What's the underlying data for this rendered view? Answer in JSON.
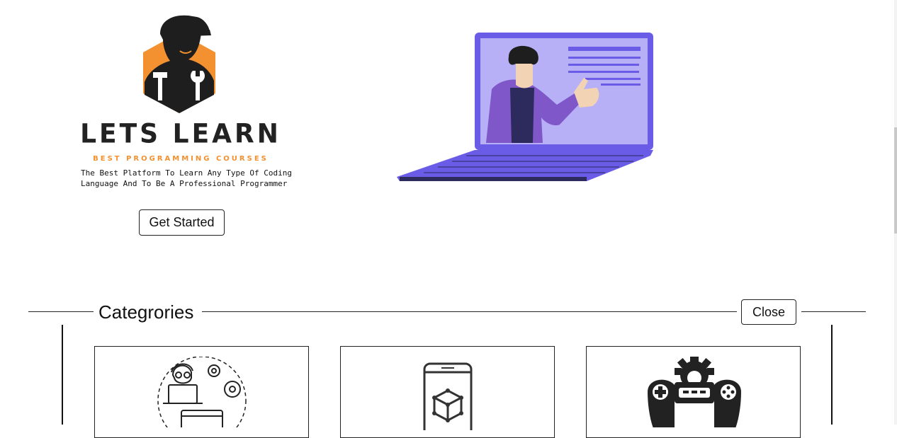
{
  "hero": {
    "brand_title": "LETS LEARN",
    "brand_subtitle": "BEST PROGRAMMING COURSES",
    "tagline": "The Best Platform To Learn Any Type Of Coding Language And To Be A Professional Programmer",
    "cta_label": "Get Started",
    "colors": {
      "accent": "#f39130",
      "laptop": "#6b5ce7"
    }
  },
  "categories": {
    "title": "Categrories",
    "close_label": "Close",
    "cards": [
      {
        "icon": "web-developer-icon"
      },
      {
        "icon": "mobile-ar-cube-icon"
      },
      {
        "icon": "game-controller-icon"
      }
    ]
  }
}
